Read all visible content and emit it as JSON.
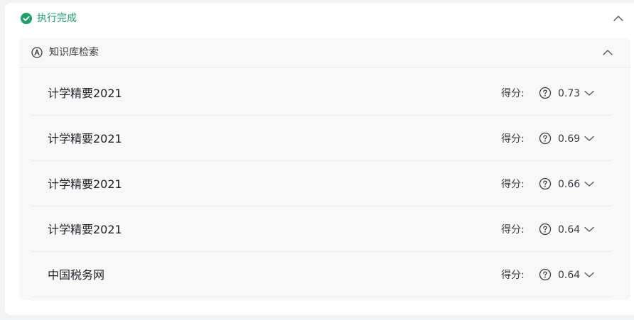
{
  "status": {
    "label": "执行完成",
    "color": "#1f9d6a",
    "icon": "check-circle-icon"
  },
  "panel": {
    "title": "知识库检索",
    "icon": "knowledge-base-icon",
    "expanded": true
  },
  "results": [
    {
      "title": "计学精要2021",
      "score_label": "得分:",
      "score": "0.73"
    },
    {
      "title": "计学精要2021",
      "score_label": "得分:",
      "score": "0.69"
    },
    {
      "title": "计学精要2021",
      "score_label": "得分:",
      "score": "0.66"
    },
    {
      "title": "计学精要2021",
      "score_label": "得分:",
      "score": "0.64"
    },
    {
      "title": "中国税务网",
      "score_label": "得分:",
      "score": "0.64"
    }
  ]
}
